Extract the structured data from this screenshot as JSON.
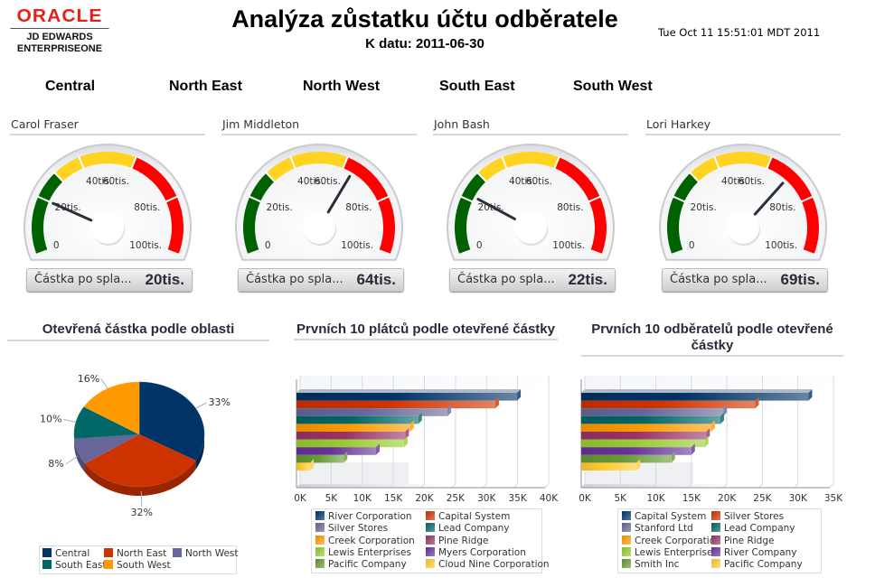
{
  "logo": {
    "brand": "ORACLE",
    "line1": "JD EDWARDS",
    "line2": "ENTERPRISEONE"
  },
  "header": {
    "title": "Analýza zůstatku účtu odběratele",
    "subtitle": "K datu: 2011-06-30",
    "timestamp": "Tue Oct 11 15:51:01 MDT 2011"
  },
  "regions": [
    "Central",
    "North East",
    "North West",
    "South East",
    "South West"
  ],
  "gauge_common": {
    "min": 0,
    "max": 100,
    "ticks": [
      "0",
      "20tis.",
      "40tis.",
      "60tis.",
      "80tis.",
      "100tis."
    ],
    "bands": [
      {
        "from": 0,
        "to": 30,
        "color": "#006100"
      },
      {
        "from": 30,
        "to": 60,
        "color": "#ffd320"
      },
      {
        "from": 60,
        "to": 100,
        "color": "#ff0000"
      }
    ],
    "readout_label": "Částka po spla..."
  },
  "gauges": [
    {
      "name": "Carol Fraser",
      "value": 20,
      "display": "20tis."
    },
    {
      "name": "Jim Middleton",
      "value": 64,
      "display": "64tis."
    },
    {
      "name": "John Bash",
      "value": 22,
      "display": "22tis."
    },
    {
      "name": "Lori Harkey",
      "value": 69,
      "display": "69tis."
    }
  ],
  "chart_data": [
    {
      "type": "pie",
      "title": "Otevřená částka podle oblasti",
      "categories": [
        "Central",
        "North East",
        "North West",
        "South East",
        "South West"
      ],
      "values": [
        33,
        32,
        8,
        10,
        16
      ],
      "labels": [
        "33%",
        "32%",
        "8%",
        "10%",
        "16%"
      ],
      "colors": [
        "#003366",
        "#cc3300",
        "#666699",
        "#006666",
        "#ff9900"
      ],
      "legend": "bottom"
    },
    {
      "type": "bar",
      "orientation": "horizontal",
      "title": "Prvních 10 plátců podle otevřené částky",
      "categories": [
        "River Corporation",
        "Capital System",
        "Silver Stores",
        "Lead Company",
        "Creek Corporation",
        "Pine Ridge",
        "Lewis Enterprises",
        "Myers Corporation",
        "Pacific Company",
        "Cloud Nine Corporation"
      ],
      "values": [
        35500,
        32000,
        24300,
        19600,
        18300,
        17500,
        17300,
        12800,
        7600,
        2200
      ],
      "colors": [
        "#003366",
        "#cc3300",
        "#666699",
        "#006666",
        "#ff9900",
        "#993366",
        "#99cc33",
        "#663399",
        "#669933",
        "#ffcc33"
      ],
      "xticks": [
        "0K",
        "5K",
        "10K",
        "15K",
        "20K",
        "25K",
        "30K",
        "35K",
        "40K"
      ],
      "xlim": [
        0,
        40000
      ],
      "grid": true,
      "legend": "bottom"
    },
    {
      "type": "bar",
      "orientation": "horizontal",
      "title": "Prvních 10 odběratelů podle otevřené částky",
      "categories": [
        "Capital System",
        "Silver Stores",
        "Stanford Ltd",
        "Lead Company",
        "Creek Corporation",
        "Pine Ridge",
        "Lewis Enterprises",
        "River Company",
        "Smith Inc",
        "Pacific Company"
      ],
      "values": [
        32000,
        24500,
        20000,
        19600,
        18300,
        17600,
        17400,
        15500,
        12700,
        7800
      ],
      "colors": [
        "#003366",
        "#cc3300",
        "#666699",
        "#006666",
        "#ff9900",
        "#993366",
        "#99cc33",
        "#663399",
        "#669933",
        "#ffcc33"
      ],
      "xticks": [
        "0K",
        "5K",
        "10K",
        "15K",
        "20K",
        "25K",
        "30K",
        "35K"
      ],
      "xlim": [
        0,
        35000
      ],
      "grid": true,
      "legend": "bottom"
    }
  ]
}
